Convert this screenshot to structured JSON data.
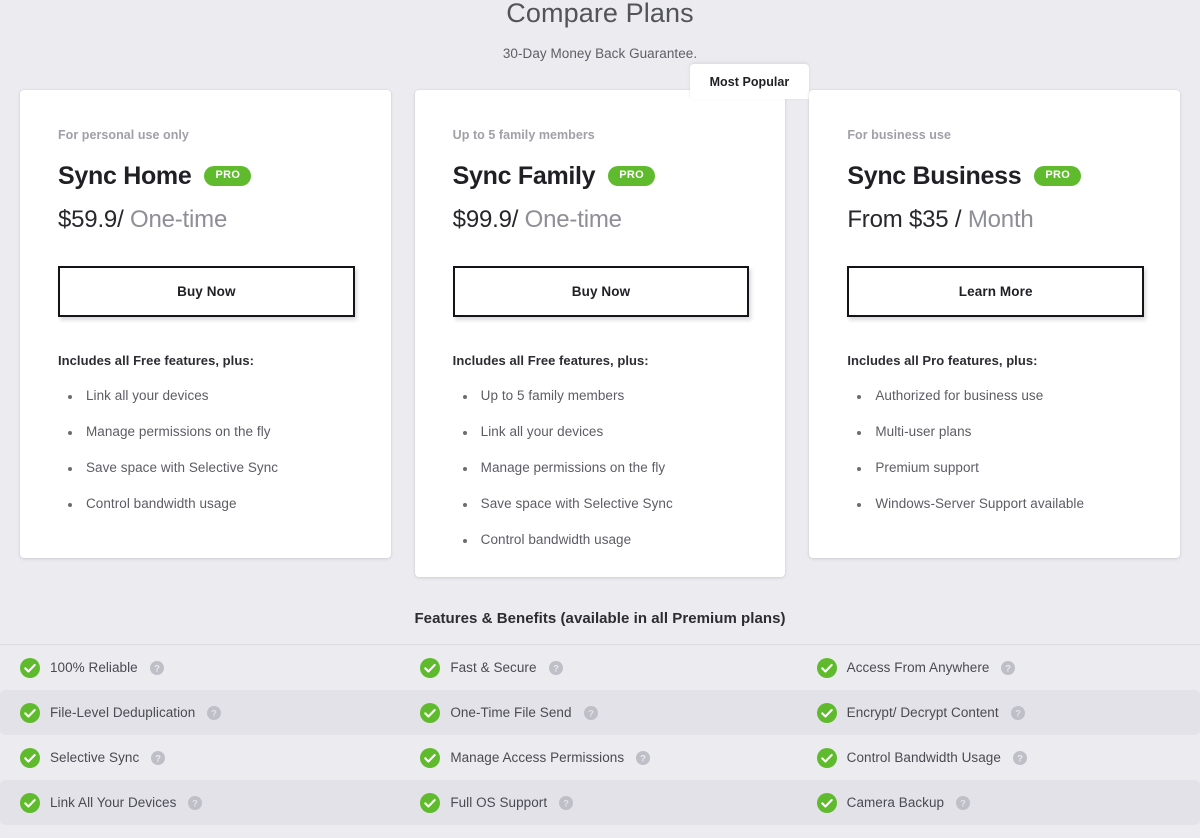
{
  "header": {
    "title": "Compare Plans",
    "subtitle": "30-Day Money Back Guarantee."
  },
  "colors": {
    "page_background": "#ECEBF0",
    "card_background": "#FFFFFF",
    "accent_green": "#5FBB2D",
    "check_green": "#5FBB2D",
    "row_stripe": "#E3E2E9",
    "cta_border": "#141418"
  },
  "plans": [
    {
      "eyebrow": "For personal use only",
      "name": "Sync Home",
      "badge": "PRO",
      "price_amount": "$59.9",
      "price_separator": "/",
      "price_period": "One-time",
      "cta_label": "Buy Now",
      "includes_label": "Includes all Free features, plus:",
      "features": [
        "Link all your devices",
        "Manage permissions on the fly",
        "Save space with Selective Sync",
        "Control bandwidth usage"
      ],
      "most_popular": null
    },
    {
      "eyebrow": "Up to 5 family members",
      "name": "Sync Family",
      "badge": "PRO",
      "price_amount": "$99.9",
      "price_separator": "/",
      "price_period": "One-time",
      "cta_label": "Buy Now",
      "includes_label": "Includes all Free features, plus:",
      "features": [
        "Up to 5 family members",
        "Link all your devices",
        "Manage permissions on the fly",
        "Save space with Selective Sync",
        "Control bandwidth usage"
      ],
      "most_popular": "Most Popular"
    },
    {
      "eyebrow": "For business use",
      "name": "Sync Business",
      "badge": "PRO",
      "price_amount": "From $35",
      "price_separator": "/",
      "price_period": "Month",
      "cta_label": "Learn More",
      "includes_label": "Includes all Pro features, plus:",
      "features": [
        "Authorized for business use",
        "Multi-user plans",
        "Premium support",
        "Windows-Server Support available"
      ],
      "most_popular": null
    }
  ],
  "benefits": {
    "title": "Features & Benefits (available in all Premium plans)",
    "rows": [
      [
        "100% Reliable",
        "Fast & Secure",
        "Access From Anywhere"
      ],
      [
        "File-Level Deduplication",
        "One-Time File Send",
        "Encrypt/ Decrypt Content"
      ],
      [
        "Selective Sync",
        "Manage Access Permissions",
        "Control Bandwidth Usage"
      ],
      [
        "Link All Your Devices",
        "Full OS Support",
        "Camera Backup"
      ]
    ]
  }
}
